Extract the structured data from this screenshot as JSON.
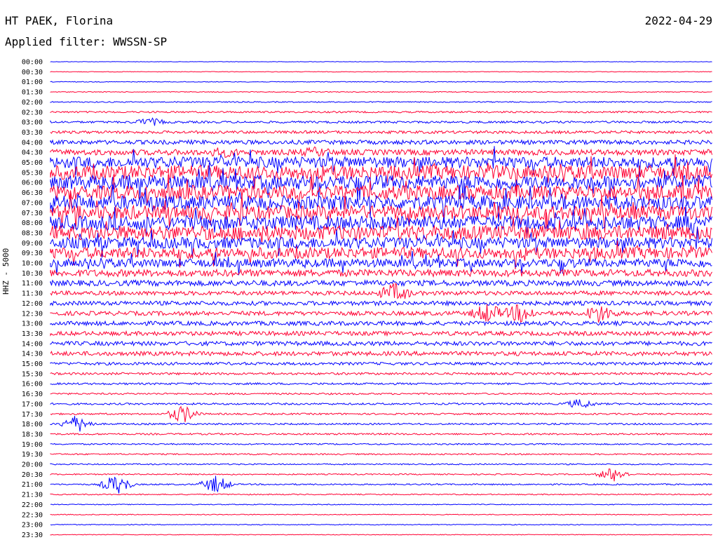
{
  "header": {
    "station": "HT PAEK, Florina",
    "date": "2022-04-29",
    "filter": "Applied filter: WWSSN-SP"
  },
  "colors": {
    "even_row": "#0000ff",
    "odd_row": "#ff0033"
  },
  "chart_data": {
    "type": "seismogram",
    "ylabel": "HHZ - 5000",
    "row_labels": [
      "00:00",
      "00:30",
      "01:00",
      "01:30",
      "02:00",
      "02:30",
      "03:00",
      "03:30",
      "04:00",
      "04:30",
      "05:00",
      "05:30",
      "06:00",
      "06:30",
      "07:00",
      "07:30",
      "08:00",
      "08:30",
      "09:00",
      "09:30",
      "10:00",
      "10:30",
      "11:00",
      "11:30",
      "12:00",
      "12:30",
      "13:00",
      "13:30",
      "14:00",
      "14:30",
      "15:00",
      "15:30",
      "16:00",
      "16:30",
      "17:00",
      "17:30",
      "18:00",
      "18:30",
      "19:00",
      "19:30",
      "20:00",
      "20:30",
      "21:00",
      "21:30",
      "22:00",
      "22:30",
      "23:00",
      "23:30"
    ],
    "noise_levels": [
      0.3,
      0.4,
      0.5,
      0.6,
      0.8,
      1.2,
      1.5,
      2,
      3,
      4,
      8,
      10,
      10,
      10,
      10,
      10,
      10,
      10,
      8,
      8,
      6,
      5,
      4,
      3,
      3,
      3,
      3,
      3,
      3,
      3,
      2,
      1.6,
      1.4,
      1.2,
      1.3,
      1.2,
      1.2,
      1.2,
      1,
      1,
      0.9,
      0.9,
      1,
      0.8,
      0.6,
      0.6,
      0.6,
      0.5
    ],
    "events": [
      {
        "row": 6,
        "t": 0.15,
        "amp": 5
      },
      {
        "row": 9,
        "t": 0.26,
        "amp": 4
      },
      {
        "row": 9,
        "t": 0.4,
        "amp": 4
      },
      {
        "row": 23,
        "t": 0.52,
        "amp": 12
      },
      {
        "row": 25,
        "t": 0.66,
        "amp": 12
      },
      {
        "row": 25,
        "t": 0.71,
        "amp": 12
      },
      {
        "row": 25,
        "t": 0.83,
        "amp": 12
      },
      {
        "row": 35,
        "t": 0.2,
        "amp": 12
      },
      {
        "row": 36,
        "t": 0.04,
        "amp": 12
      },
      {
        "row": 34,
        "t": 0.8,
        "amp": 6
      },
      {
        "row": 42,
        "t": 0.1,
        "amp": 14
      },
      {
        "row": 42,
        "t": 0.25,
        "amp": 12
      },
      {
        "row": 41,
        "t": 0.85,
        "amp": 10
      }
    ]
  }
}
